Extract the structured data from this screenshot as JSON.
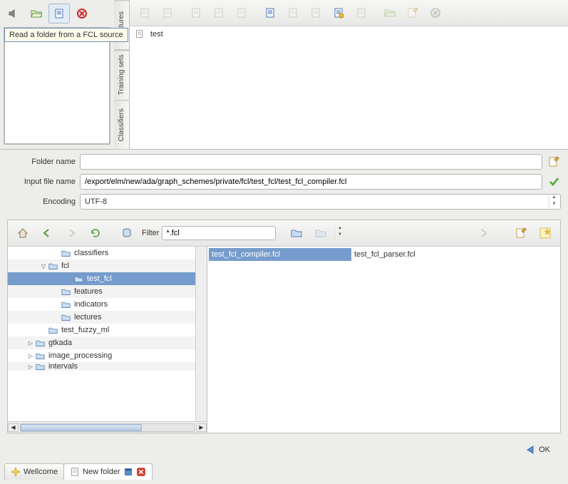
{
  "tooltip": "Read a folder from a FCL source",
  "vertical_tabs": [
    "Features",
    "Training sets",
    "Classifiers"
  ],
  "main_item": "test",
  "form": {
    "folder_name_label": "Folder name",
    "folder_name_value": "",
    "input_file_label": "Input file name",
    "input_file_value": "/export/elm/new/ada/graph_schemes/private/fcl/test_fcl/test_fcl_compiler.fcl",
    "encoding_label": "Encoding",
    "encoding_value": "UTF-8"
  },
  "browser": {
    "filter_label": "Filter",
    "filter_value": "*.fcl",
    "combo_value": ""
  },
  "tree": [
    {
      "indent": 3,
      "label": "classifiers",
      "arrow": "",
      "alt": false,
      "sel": false
    },
    {
      "indent": 2,
      "label": "fcl",
      "arrow": "▽",
      "alt": true,
      "sel": false
    },
    {
      "indent": 4,
      "label": "test_fcl",
      "arrow": "",
      "alt": false,
      "sel": true
    },
    {
      "indent": 3,
      "label": "features",
      "arrow": "",
      "alt": true,
      "sel": false
    },
    {
      "indent": 3,
      "label": "indicators",
      "arrow": "",
      "alt": false,
      "sel": false
    },
    {
      "indent": 3,
      "label": "lectures",
      "arrow": "",
      "alt": true,
      "sel": false
    },
    {
      "indent": 2,
      "label": "test_fuzzy_ml",
      "arrow": "",
      "alt": false,
      "sel": false
    },
    {
      "indent": 1,
      "label": "gtkada",
      "arrow": "▷",
      "alt": true,
      "sel": false
    },
    {
      "indent": 1,
      "label": "image_processing",
      "arrow": "▷",
      "alt": false,
      "sel": false
    },
    {
      "indent": 1,
      "label": "intervals",
      "arrow": "▷",
      "alt": true,
      "sel": false,
      "cut": true
    }
  ],
  "files": [
    {
      "name": "test_fcl_compiler.fcl",
      "sel": true
    },
    {
      "name": "test_fcl_parser.fcl",
      "sel": false
    }
  ],
  "ok_label": "OK",
  "bottom_tabs": {
    "wellcome": "Wellcome",
    "new_folder": "New folder"
  }
}
